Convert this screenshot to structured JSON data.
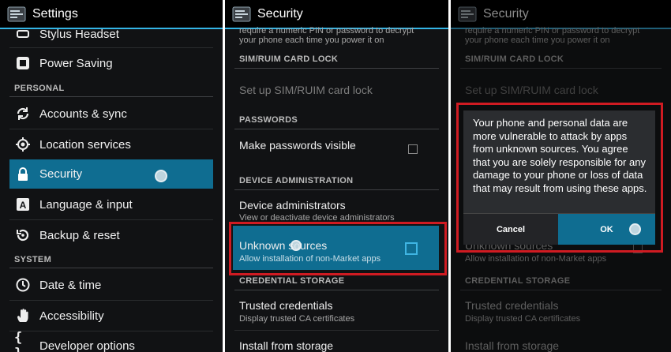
{
  "panel1": {
    "title": "Settings",
    "items_top": [
      {
        "label": "Stylus Headset",
        "icon": "stylus-icon"
      },
      {
        "label": "Power Saving",
        "icon": "power-saving-icon"
      }
    ],
    "header_personal": "PERSONAL",
    "items_personal": [
      {
        "label": "Accounts & sync",
        "icon": "sync-icon"
      },
      {
        "label": "Location services",
        "icon": "location-icon"
      },
      {
        "label": "Security",
        "icon": "lock-icon"
      },
      {
        "label": "Language & input",
        "icon": "language-icon"
      },
      {
        "label": "Backup & reset",
        "icon": "backup-icon"
      }
    ],
    "header_system": "SYSTEM",
    "items_system": [
      {
        "label": "Date & time",
        "icon": "clock-icon"
      },
      {
        "label": "Accessibility",
        "icon": "hand-icon"
      },
      {
        "label": "Developer options",
        "icon": "braces-icon"
      }
    ],
    "selected": "Security"
  },
  "security": {
    "title": "Security",
    "pin_line1": "require a numeric PIN or password to decrypt",
    "pin_line2": "your phone each time you power it on",
    "header_sim": "SIM/RUIM CARD LOCK",
    "sim_lock": "Set up SIM/RUIM card lock",
    "header_passwords": "PASSWORDS",
    "make_visible": "Make passwords visible",
    "header_device_admin": "DEVICE ADMINISTRATION",
    "device_admins": "Device administrators",
    "device_admins_sub": "View or deactivate device administrators",
    "unknown_sources": "Unknown sources",
    "unknown_sources_sub": "Allow installation of non-Market apps",
    "header_credential": "CREDENTIAL STORAGE",
    "trusted_credentials": "Trusted credentials",
    "trusted_credentials_sub": "Display trusted CA certificates",
    "install_storage": "Install from storage"
  },
  "dialog": {
    "message": "Your phone and personal data are more vulnerable to attack by apps from unknown sources. You agree that you are solely responsible for any damage to your phone or loss of data that may result from using these apps.",
    "cancel": "Cancel",
    "ok": "OK"
  },
  "colors": {
    "accent": "#33b5e5",
    "selection": "#0f6d91",
    "highlight_border": "#d01b22",
    "background": "#111214"
  }
}
